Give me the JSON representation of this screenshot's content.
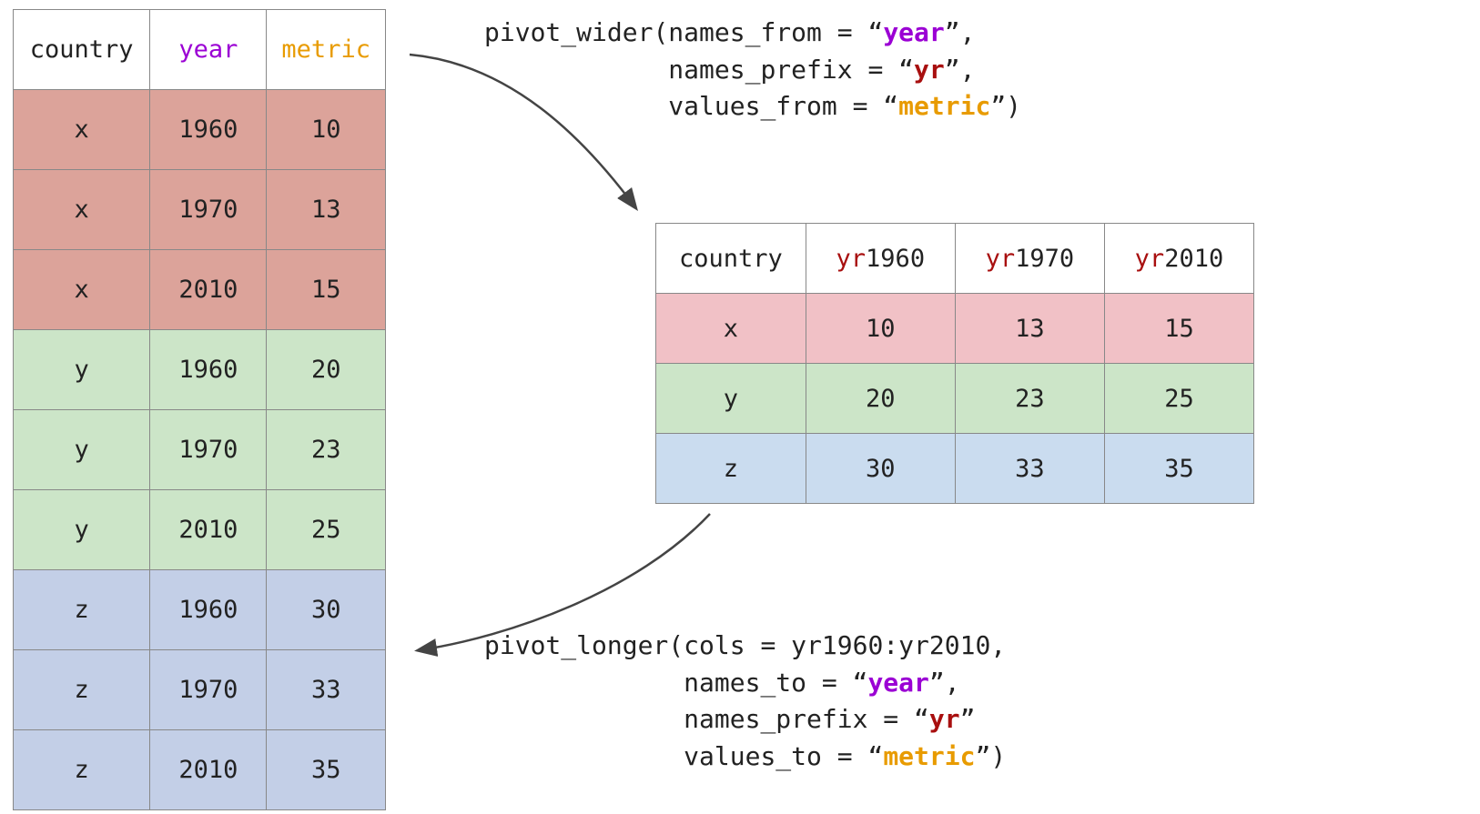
{
  "colors": {
    "year": "#9b00d4",
    "metric": "#e89b00",
    "yr_prefix": "#a80f0f",
    "group_x_long": "#dca39a",
    "group_y_long": "#cce5c8",
    "group_z_long": "#c3cfe7",
    "group_x_wide": "#f1c1c6",
    "group_y_wide": "#cce5c8",
    "group_z_wide": "#cadcef"
  },
  "long_table": {
    "headers": {
      "country": "country",
      "year": "year",
      "metric": "metric"
    },
    "rows": [
      {
        "group": "x",
        "country": "x",
        "year": "1960",
        "metric": "10"
      },
      {
        "group": "x",
        "country": "x",
        "year": "1970",
        "metric": "13"
      },
      {
        "group": "x",
        "country": "x",
        "year": "2010",
        "metric": "15"
      },
      {
        "group": "y",
        "country": "y",
        "year": "1960",
        "metric": "20"
      },
      {
        "group": "y",
        "country": "y",
        "year": "1970",
        "metric": "23"
      },
      {
        "group": "y",
        "country": "y",
        "year": "2010",
        "metric": "25"
      },
      {
        "group": "z",
        "country": "z",
        "year": "1960",
        "metric": "30"
      },
      {
        "group": "z",
        "country": "z",
        "year": "1970",
        "metric": "33"
      },
      {
        "group": "z",
        "country": "z",
        "year": "2010",
        "metric": "35"
      }
    ]
  },
  "wide_table": {
    "headers": {
      "country": "country",
      "cols": [
        {
          "prefix": "yr",
          "year": "1960"
        },
        {
          "prefix": "yr",
          "year": "1970"
        },
        {
          "prefix": "yr",
          "year": "2010"
        }
      ]
    },
    "rows": [
      {
        "group": "x",
        "country": "x",
        "v0": "10",
        "v1": "13",
        "v2": "15"
      },
      {
        "group": "y",
        "country": "y",
        "v0": "20",
        "v1": "23",
        "v2": "25"
      },
      {
        "group": "z",
        "country": "z",
        "v0": "30",
        "v1": "33",
        "v2": "35"
      }
    ]
  },
  "code_wider": {
    "fn": "pivot_wider",
    "l1a": "(names_from = “",
    "l1b": "year",
    "l1c": "”,",
    "pad2": "            ",
    "l2a": "names_prefix = “",
    "l2b": "yr",
    "l2c": "”,",
    "pad3": "            ",
    "l3a": "values_from = “",
    "l3b": "metric",
    "l3c": "”)"
  },
  "code_longer": {
    "fn": "pivot_longer",
    "l1a": "(cols = yr1960:yr2010,",
    "pad2": "             ",
    "l2a": "names_to = “",
    "l2b": "year",
    "l2c": "”,",
    "pad3": "             ",
    "l3a": "names_prefix = “",
    "l3b": "yr",
    "l3c": "”",
    "pad4": "             ",
    "l4a": "values_to = “",
    "l4b": "metric",
    "l4c": "”)"
  }
}
